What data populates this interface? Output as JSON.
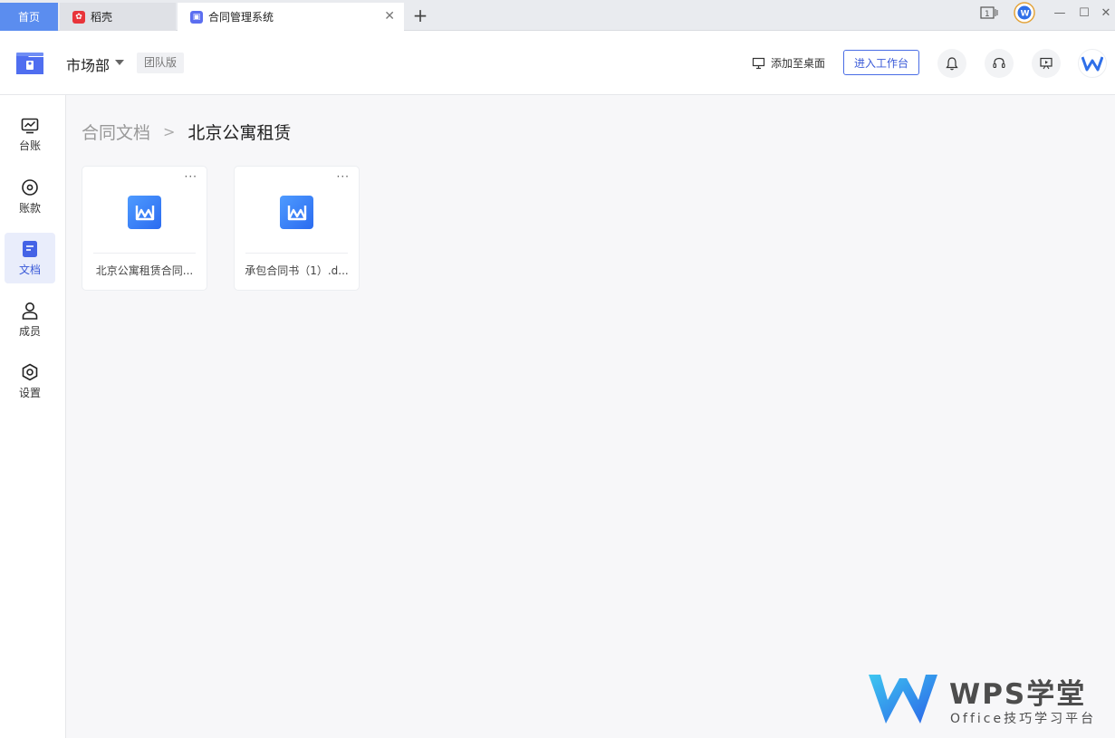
{
  "tabs": {
    "home": "首页",
    "daoke": "稻壳",
    "contract": "合同管理系统"
  },
  "header": {
    "department": "市场部",
    "team_badge": "团队版",
    "add_to_desktop": "添加至桌面",
    "enter_workbench": "进入工作台"
  },
  "sidebar": {
    "items": [
      {
        "label": "台账",
        "icon": "chart-monitor-icon"
      },
      {
        "label": "账款",
        "icon": "target-icon"
      },
      {
        "label": "文档",
        "icon": "document-icon"
      },
      {
        "label": "成员",
        "icon": "person-icon"
      },
      {
        "label": "设置",
        "icon": "gear-icon"
      }
    ]
  },
  "breadcrumb": {
    "parent": "合同文档",
    "separator": ">",
    "current": "北京公寓租赁"
  },
  "files": [
    {
      "name": "北京公寓租赁合同...",
      "icon": "wps-writer-icon"
    },
    {
      "name": "承包合同书（1）.d...",
      "icon": "wps-writer-icon"
    }
  ],
  "watermark": {
    "title": "WPS学堂",
    "subtitle": "Office技巧学习平台"
  },
  "colors": {
    "accent": "#3a5ad8",
    "home_tab": "#5b8def"
  }
}
